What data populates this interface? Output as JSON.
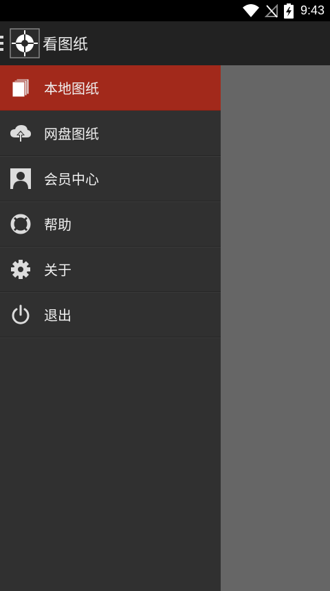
{
  "status_bar": {
    "time": "9:43",
    "icons": [
      "wifi-icon",
      "no-signal-icon",
      "battery-charging-icon"
    ]
  },
  "app_bar": {
    "title": "看图纸",
    "logo_icon": "crosshair-logo-icon"
  },
  "drawer": {
    "items": [
      {
        "label": "本地图纸",
        "icon": "documents-icon",
        "active": true
      },
      {
        "label": "网盘图纸",
        "icon": "cloud-upload-icon",
        "active": false
      },
      {
        "label": "会员中心",
        "icon": "user-profile-icon",
        "active": false
      },
      {
        "label": "帮助",
        "icon": "lifebuoy-icon",
        "active": false
      },
      {
        "label": "关于",
        "icon": "gear-icon",
        "active": false
      },
      {
        "label": "退出",
        "icon": "power-icon",
        "active": false
      }
    ]
  },
  "colors": {
    "accent": "#a2291b",
    "drawer_bg": "#303030",
    "app_bar_bg": "#222222",
    "status_bar_bg": "#000000",
    "scrim": "#666666"
  }
}
